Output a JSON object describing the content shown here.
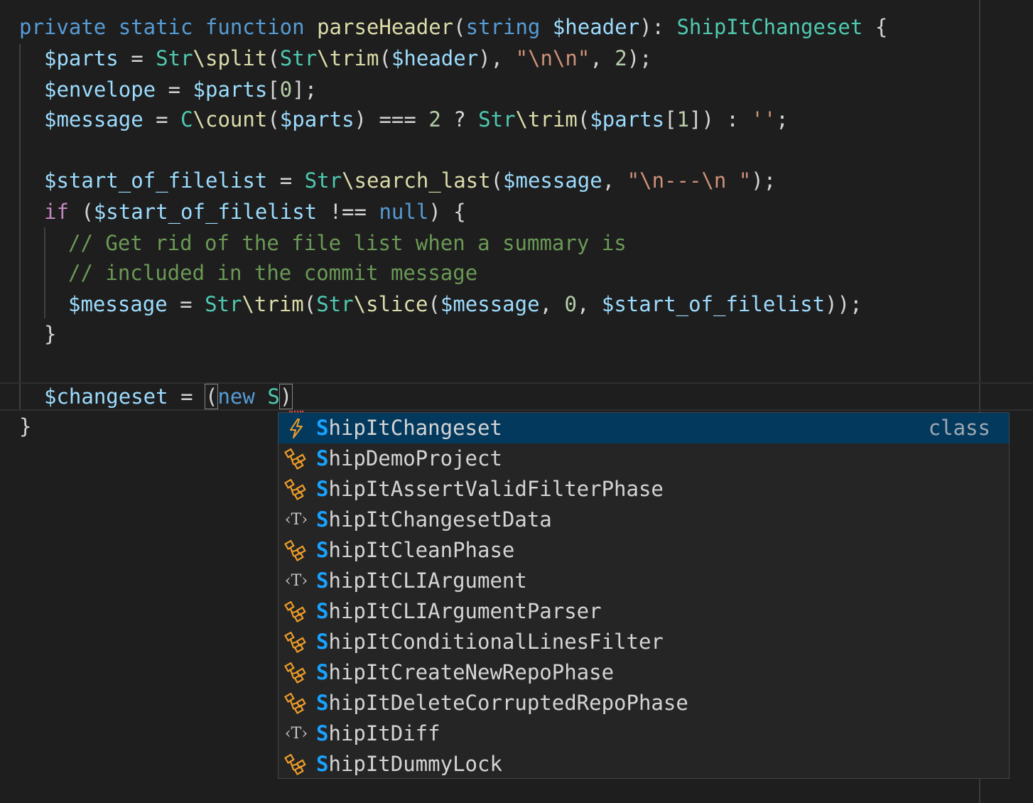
{
  "code": {
    "line1": {
      "private": "private",
      "static": "static",
      "function": "function",
      "name": "parseHeader",
      "open": "(",
      "ptype": "string",
      "param": "$header",
      "close": "): ",
      "ret": "ShipItChangeset",
      "brace": " {"
    },
    "line2": {
      "var": "$parts",
      "eq": " = ",
      "ns1": "Str",
      "fn1": "\\split",
      "p1": "(",
      "ns2": "Str",
      "fn2": "\\trim",
      "p2": "(",
      "arg": "$header",
      "c1": "), ",
      "str": "\"\\n\\n\"",
      "c2": ", ",
      "num": "2",
      "end": ");"
    },
    "line3": {
      "var": "$envelope",
      "eq": " = ",
      "arr": "$parts",
      "b1": "[",
      "num": "0",
      "b2": "];"
    },
    "line4": {
      "var": "$message",
      "eq": " = ",
      "ns1": "C",
      "fn1": "\\count",
      "p1": "(",
      "arg": "$parts",
      "op": ") === ",
      "num": "2",
      "q": " ? ",
      "ns2": "Str",
      "fn2": "\\trim",
      "p2": "(",
      "arr": "$parts",
      "b1": "[",
      "idx": "1",
      "b2": "]) : ",
      "str": "''",
      "end": ";"
    },
    "line5": {
      "var": "$start_of_filelist",
      "eq": " = ",
      "ns": "Str",
      "fn": "\\search_last",
      "p1": "(",
      "arg": "$message",
      "c": ", ",
      "str": "\"\\n---\\n \"",
      "end": ");"
    },
    "line6": {
      "kw": "if",
      "p1": " (",
      "var": "$start_of_filelist",
      "op": " !== ",
      "null": "null",
      "end": ") {"
    },
    "line7": {
      "comment": "// Get rid of the file list when a summary is"
    },
    "line8": {
      "comment": "// included in the commit message"
    },
    "line9": {
      "var": "$message",
      "eq": " = ",
      "ns1": "Str",
      "fn1": "\\trim",
      "p1": "(",
      "ns2": "Str",
      "fn2": "\\slice",
      "p2": "(",
      "arg": "$message",
      "c1": ", ",
      "num": "0",
      "c2": ", ",
      "arg2": "$start_of_filelist",
      "end": "));"
    },
    "line10": {
      "brace": "}"
    },
    "line11": {
      "var": "$changeset",
      "eq": " = ",
      "open": "(",
      "kw": "new",
      "sp": " ",
      "typed": "S",
      "close": ")"
    },
    "line12": {
      "brace": "}"
    }
  },
  "suggestions": {
    "match_prefix": "S",
    "items": [
      {
        "label": "ShipItChangeset",
        "icon": "bolt-icon",
        "detail": "class",
        "selected": true
      },
      {
        "label": "ShipDemoProject",
        "icon": "class-icon",
        "detail": "",
        "selected": false
      },
      {
        "label": "ShipItAssertValidFilterPhase",
        "icon": "class-icon",
        "detail": "",
        "selected": false
      },
      {
        "label": "ShipItChangesetData",
        "icon": "type-parameter-icon",
        "detail": "",
        "selected": false
      },
      {
        "label": "ShipItCleanPhase",
        "icon": "class-icon",
        "detail": "",
        "selected": false
      },
      {
        "label": "ShipItCLIArgument",
        "icon": "type-parameter-icon",
        "detail": "",
        "selected": false
      },
      {
        "label": "ShipItCLIArgumentParser",
        "icon": "class-icon",
        "detail": "",
        "selected": false
      },
      {
        "label": "ShipItConditionalLinesFilter",
        "icon": "class-icon",
        "detail": "",
        "selected": false
      },
      {
        "label": "ShipItCreateNewRepoPhase",
        "icon": "class-icon",
        "detail": "",
        "selected": false
      },
      {
        "label": "ShipItDeleteCorruptedRepoPhase",
        "icon": "class-icon",
        "detail": "",
        "selected": false
      },
      {
        "label": "ShipItDiff",
        "icon": "type-parameter-icon",
        "detail": "",
        "selected": false
      },
      {
        "label": "ShipItDummyLock",
        "icon": "class-icon",
        "detail": "",
        "selected": false
      }
    ]
  },
  "colors": {
    "background": "#1e1e1e",
    "selection": "#04395e",
    "match_highlight": "#18a3ff",
    "class_icon": "#ee9d28"
  }
}
